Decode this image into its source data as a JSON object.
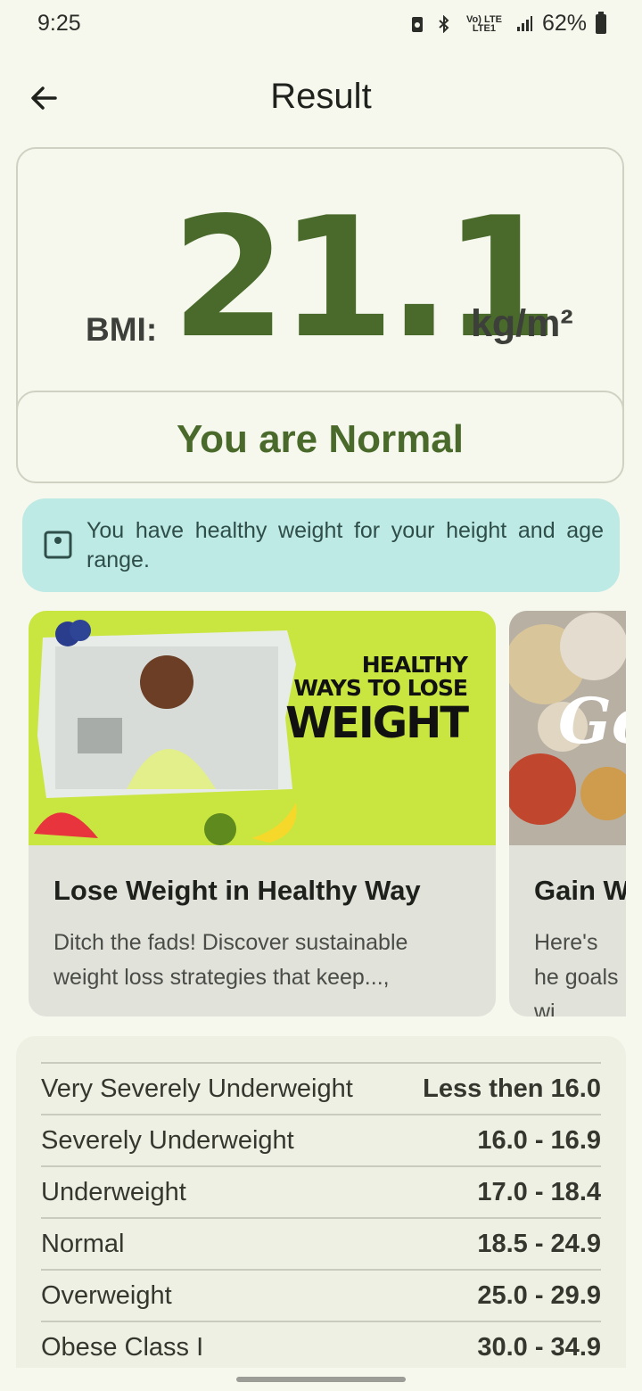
{
  "status_bar": {
    "time": "9:25",
    "network": "Vo) LTE LTE1",
    "battery": "62%"
  },
  "app_bar": {
    "title": "Result"
  },
  "result": {
    "bmi_label": "BMI:",
    "bmi_value": "21.1",
    "unit": "kg/m²",
    "status": "You are Normal"
  },
  "info_banner": {
    "text": "You have healthy weight for your height and age range."
  },
  "cards": [
    {
      "image_text": [
        "HEALTHY",
        "WAYS TO LOSE",
        "WEIGHT"
      ],
      "title": "Lose Weight in Healthy Way",
      "description": "Ditch the fads! Discover sustainable weight loss strategies that keep...,"
    },
    {
      "image_text": [
        "Go"
      ],
      "title": "Gain W",
      "description": "Here's he goals wi"
    }
  ],
  "ranges": [
    {
      "label": "Very Severely Underweight",
      "value": "Less then 16.0"
    },
    {
      "label": "Severely Underweight",
      "value": "16.0 - 16.9"
    },
    {
      "label": "Underweight",
      "value": "17.0 - 18.4"
    },
    {
      "label": "Normal",
      "value": "18.5 - 24.9"
    },
    {
      "label": "Overweight",
      "value": "25.0 - 29.9"
    },
    {
      "label": "Obese Class I",
      "value": "30.0 - 34.9"
    }
  ],
  "colors": {
    "accent": "#4a6a2b",
    "info_bg": "#bdeae4",
    "background": "#f6f8ee"
  }
}
